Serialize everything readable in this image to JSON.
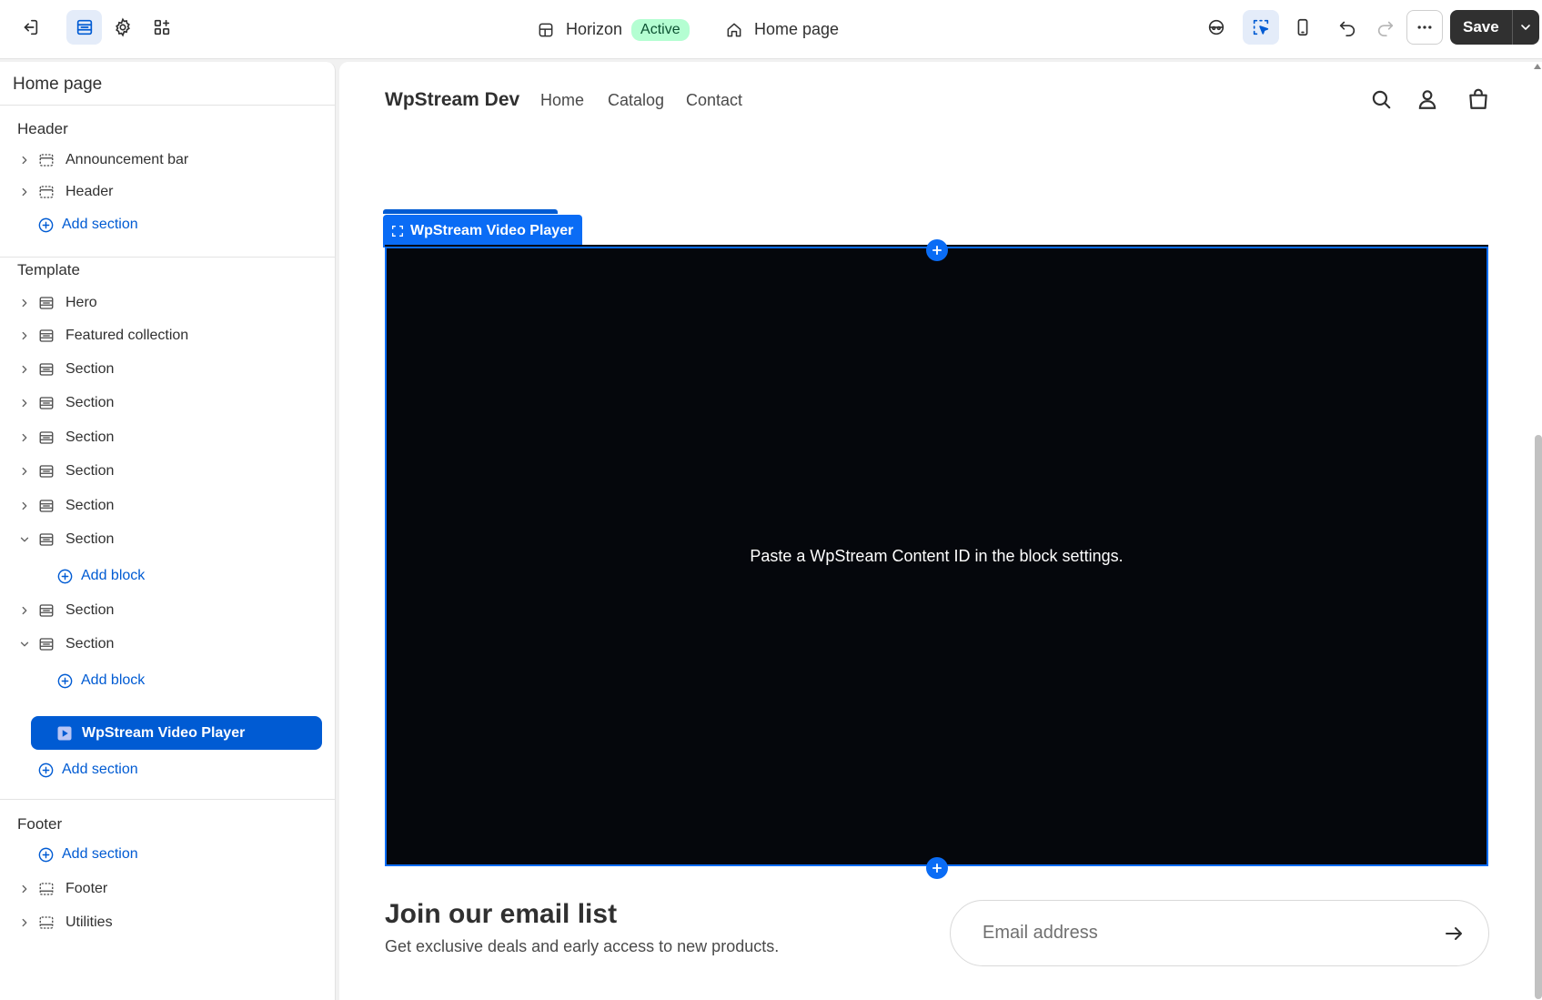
{
  "topbar": {
    "theme_name": "Horizon",
    "theme_status": "Active",
    "page_name": "Home page",
    "save_label": "Save"
  },
  "sidebar": {
    "title": "Home page",
    "header_group": {
      "title": "Header",
      "items": [
        "Announcement bar",
        "Header"
      ],
      "add_label": "Add section"
    },
    "template_group": {
      "title": "Template",
      "items": [
        "Hero",
        "Featured collection",
        "Section",
        "Section",
        "Section",
        "Section",
        "Section",
        "Section",
        "Section",
        "Section"
      ],
      "add_block_label": "Add block",
      "selected_block": "WpStream Video Player",
      "add_label": "Add section"
    },
    "footer_group": {
      "title": "Footer",
      "add_label": "Add section",
      "items": [
        "Footer",
        "Utilities"
      ]
    }
  },
  "preview": {
    "store_name": "WpStream Dev",
    "nav": [
      "Home",
      "Catalog",
      "Contact"
    ],
    "block_tab_label": "WpStream Video Player",
    "video_message": "Paste a WpStream Content ID in the block settings.",
    "email_title": "Join our email list",
    "email_subtitle": "Get exclusive deals and early access to new products.",
    "email_placeholder": "Email address"
  },
  "colors": {
    "accent": "#005bd3",
    "badge_bg": "#b4fed2",
    "video_bg": "#05070c"
  }
}
